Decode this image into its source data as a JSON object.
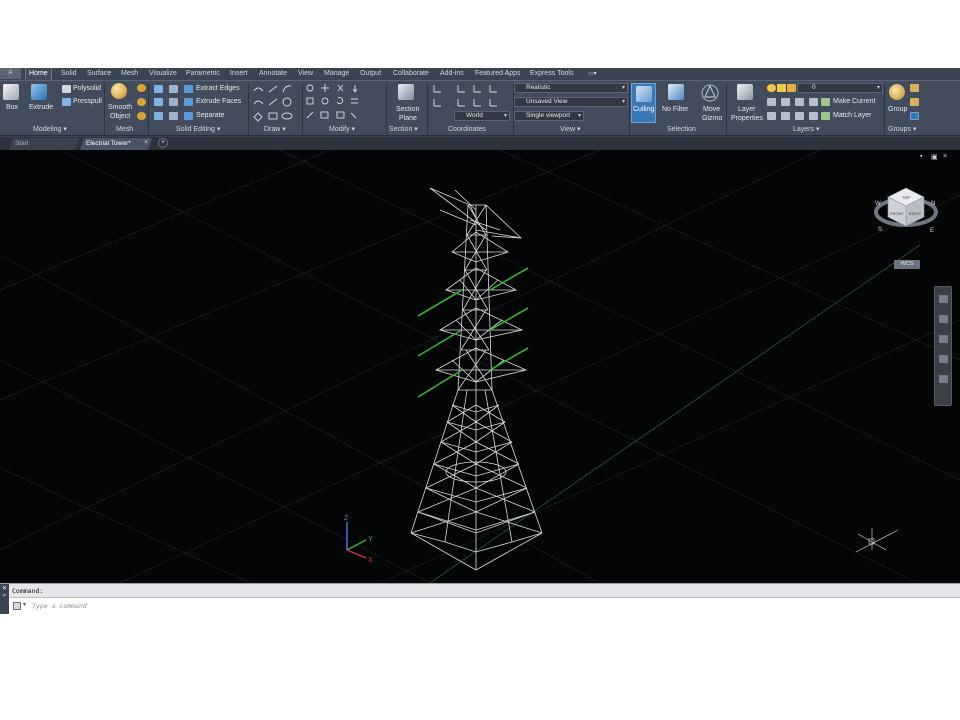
{
  "app_button": "A",
  "ribbon_tabs": [
    {
      "label": "Home",
      "active": true
    },
    {
      "label": "Solid"
    },
    {
      "label": "Surface"
    },
    {
      "label": "Mesh"
    },
    {
      "label": "Visualize"
    },
    {
      "label": "Parametric"
    },
    {
      "label": "Insert"
    },
    {
      "label": "Annotate"
    },
    {
      "label": "View"
    },
    {
      "label": "Manage"
    },
    {
      "label": "Output"
    },
    {
      "label": "Collaborate"
    },
    {
      "label": "Add-ins"
    },
    {
      "label": "Featured Apps"
    },
    {
      "label": "Express Tools"
    }
  ],
  "ribbon": {
    "modeling": {
      "box": "Box",
      "extrude": "Extrude",
      "polysolid": "Polysolid",
      "presspull": "Presspull",
      "panel": "Modeling ▾"
    },
    "mesh": {
      "smooth": "Smooth",
      "object": "Object",
      "panel": "Mesh"
    },
    "solid_editing": {
      "extract_edges": "Extract Edges",
      "extrude_faces": "Extrude Faces",
      "separate": "Separate",
      "panel": "Solid Editing ▾"
    },
    "draw": {
      "panel": "Draw ▾"
    },
    "modify": {
      "panel": "Modify ▾"
    },
    "section": {
      "section": "Section",
      "plane": "Plane",
      "panel": "Section ▾"
    },
    "coordinates": {
      "world": "World",
      "panel": "Coordinates"
    },
    "view": {
      "visual_style": "Realistic",
      "saved_view": "Unsaved View",
      "viewport": "Single viewport",
      "panel": "View ▾"
    },
    "selection": {
      "culling": "Culling",
      "no_filter": "No Filter",
      "move": "Move",
      "gizmo": "Gizmo",
      "panel": "Selection"
    },
    "layers": {
      "layer": "Layer",
      "properties": "Properties",
      "current_layer": "0",
      "make_current": "Make Current",
      "match_layer": "Match Layer",
      "panel": "Layers ▾"
    },
    "groups": {
      "group": "Group",
      "panel": "Groups ▾"
    }
  },
  "doc_tabs": [
    {
      "label": "Start"
    },
    {
      "label": "Electrial Tower*",
      "active": true
    }
  ],
  "viewcube": {
    "top": "TOP",
    "front": "FRONT",
    "right": "RIGHT",
    "wcs": "WCS"
  },
  "command": {
    "history": "Command:",
    "placeholder": "Type a command"
  },
  "colors": {
    "ribbon_bg": "#424c5d",
    "viewport_bg": "#040506",
    "tower_stroke": "#d8dadd",
    "crossarm_green": "#2fb52f",
    "active_blue": "#3a78b8"
  }
}
